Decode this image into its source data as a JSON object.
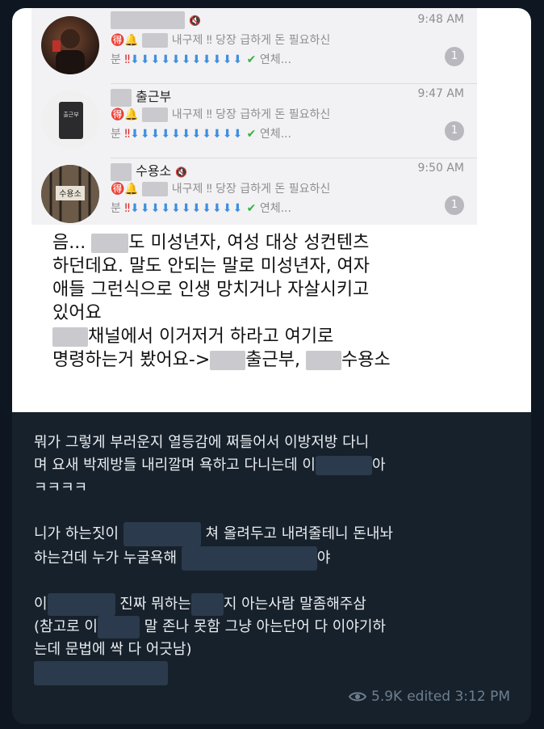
{
  "screenshot": {
    "chats": [
      {
        "name": "",
        "time": "9:48 AM",
        "preview_line1": "내구제 ‼ 당장 급하게 돈 필요하신",
        "preview_line2_prefix": "분",
        "preview_line2_suffix": "연체...",
        "badge": "1"
      },
      {
        "name": "출근부",
        "time": "9:47 AM",
        "preview_line1": "내구제 ‼ 당장 급하게 돈 필요하신",
        "preview_line2_prefix": "분",
        "preview_line2_suffix": "연체...",
        "badge": "1"
      },
      {
        "name": "수용소",
        "time": "9:50 AM",
        "preview_line1": "내구제 ‼ 당장 급하게 돈 필요하신",
        "preview_line2_prefix": "분",
        "preview_line2_suffix": "연체...",
        "badge": "1"
      }
    ],
    "text": {
      "l1a": "음... ",
      "l1b": "도 미성년자, 여성 대상 성컨텐츠",
      "l2": "하던데요.  말도 안되는 말로 미성년자, 여자",
      "l3": "애들 그런식으로 인생 망치거나 자살시키고",
      "l4": "있어요",
      "l5": "채널에서 이거저거 하라고 여기로",
      "l6a": "명령하는거 봤어요->",
      "l6b": "출근부, ",
      "l6c": "수용소"
    }
  },
  "message": {
    "p1_l1": "뭐가 그렇게 부러운지 열등감에 쩌들어서 이방저방 다니",
    "p1_l2a": "며 요새 박제방들 내리깔며 욕하고 다니는데 이",
    "p1_l2b": "아",
    "p1_l3": "ㅋㅋㅋㅋ",
    "p2_l1a": "니가 하는짓이 ",
    "p2_l1b": "쳐 올려두고 내려줄테니 돈내놔",
    "p2_l2a": "하는건데 누가 누굴욕해 ",
    "p2_l2b": "야",
    "p3_l1a": "이",
    "p3_l1b": "진짜 뭐하는",
    "p3_l1c": "지 아는사람 말좀해주삼",
    "p3_l2a": "(참고로 이",
    "p3_l2b": " 말 존나 못함 그냥 아는단어 다 이야기하",
    "p3_l3": "는데 문법에 싹 다 어긋남)"
  },
  "meta": {
    "views": "5.9K",
    "edited": "edited 3:12 PM"
  },
  "colors": {
    "bg": "#0e1621",
    "bubble": "#17212b",
    "text": "#e9edf2",
    "meta": "#6d7f8f"
  }
}
